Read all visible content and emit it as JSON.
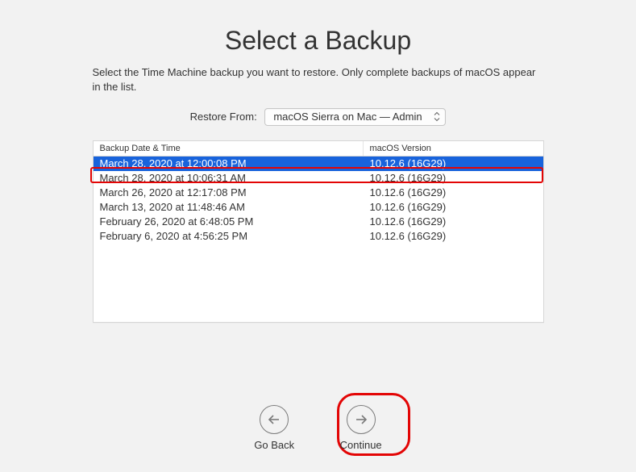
{
  "title": "Select a Backup",
  "subtitle": "Select the Time Machine backup you want to restore. Only complete backups of macOS appear in the list.",
  "restore": {
    "label": "Restore From:",
    "selected": "macOS Sierra on Mac — Admin"
  },
  "table": {
    "columns": {
      "date": "Backup Date & Time",
      "version": "macOS Version"
    },
    "rows": [
      {
        "date": "March 28, 2020 at 12:00:08 PM",
        "version": "10.12.6 (16G29)",
        "selected": true
      },
      {
        "date": "March 28, 2020 at 10:06:31 AM",
        "version": "10.12.6 (16G29)",
        "selected": false
      },
      {
        "date": "March 26, 2020 at 12:17:08 PM",
        "version": "10.12.6 (16G29)",
        "selected": false
      },
      {
        "date": "March 13, 2020 at 11:48:46 AM",
        "version": "10.12.6 (16G29)",
        "selected": false
      },
      {
        "date": "February 26, 2020 at 6:48:05 PM",
        "version": "10.12.6 (16G29)",
        "selected": false
      },
      {
        "date": "February 6, 2020 at 4:56:25 PM",
        "version": "10.12.6 (16G29)",
        "selected": false
      }
    ]
  },
  "footer": {
    "go_back": "Go Back",
    "continue": "Continue"
  }
}
